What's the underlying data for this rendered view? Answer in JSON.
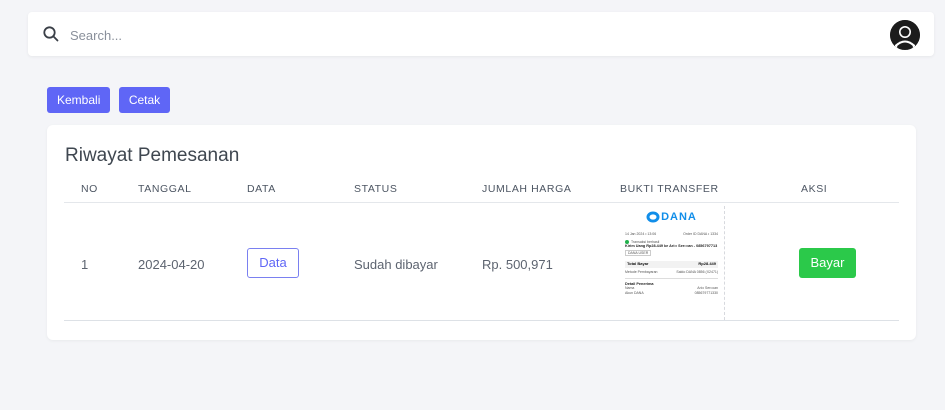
{
  "search": {
    "placeholder": "Search..."
  },
  "actions": {
    "back_label": "Kembali",
    "print_label": "Cetak"
  },
  "card": {
    "title": "Riwayat Pemesanan"
  },
  "table": {
    "headers": [
      "NO",
      "TANGGAL",
      "DATA",
      "STATUS",
      "JUMLAH HARGA",
      "BUKTI TRANSFER",
      "AKSI"
    ],
    "rows": [
      {
        "no": "1",
        "tanggal": "2024-04-20",
        "data_button": "Data",
        "status": "Sudah dibayar",
        "jumlah_harga": "Rp. 500,971",
        "aksi_button": "Bayar"
      }
    ]
  },
  "receipt": {
    "brand": "DANA",
    "datetime": "14 Jan 2024 • 13:06",
    "trx_id": "Order ID DANA • 1334",
    "status_line": "Transaksi berhasil",
    "description": "Kirim Uang Rp28.449 ke Ari•• Ser•••an - 0856797713",
    "tag": "DANA USER",
    "total_label": "Total Bayar",
    "total_value": "Rp28.449",
    "method_label": "Metode Pembayaran",
    "method_value": "Saldo DANA 0856 (X2471)",
    "recipient_title": "Detail Penerima",
    "name_label": "Nama",
    "name_value": "Ari•• Ser•••an",
    "account_label": "Akun DANA",
    "account_value": "085679771330"
  },
  "colors": {
    "primary": "#5f66f6",
    "success": "#2bc94a",
    "background": "#f4f5f8",
    "dana_blue": "#118ee9"
  }
}
